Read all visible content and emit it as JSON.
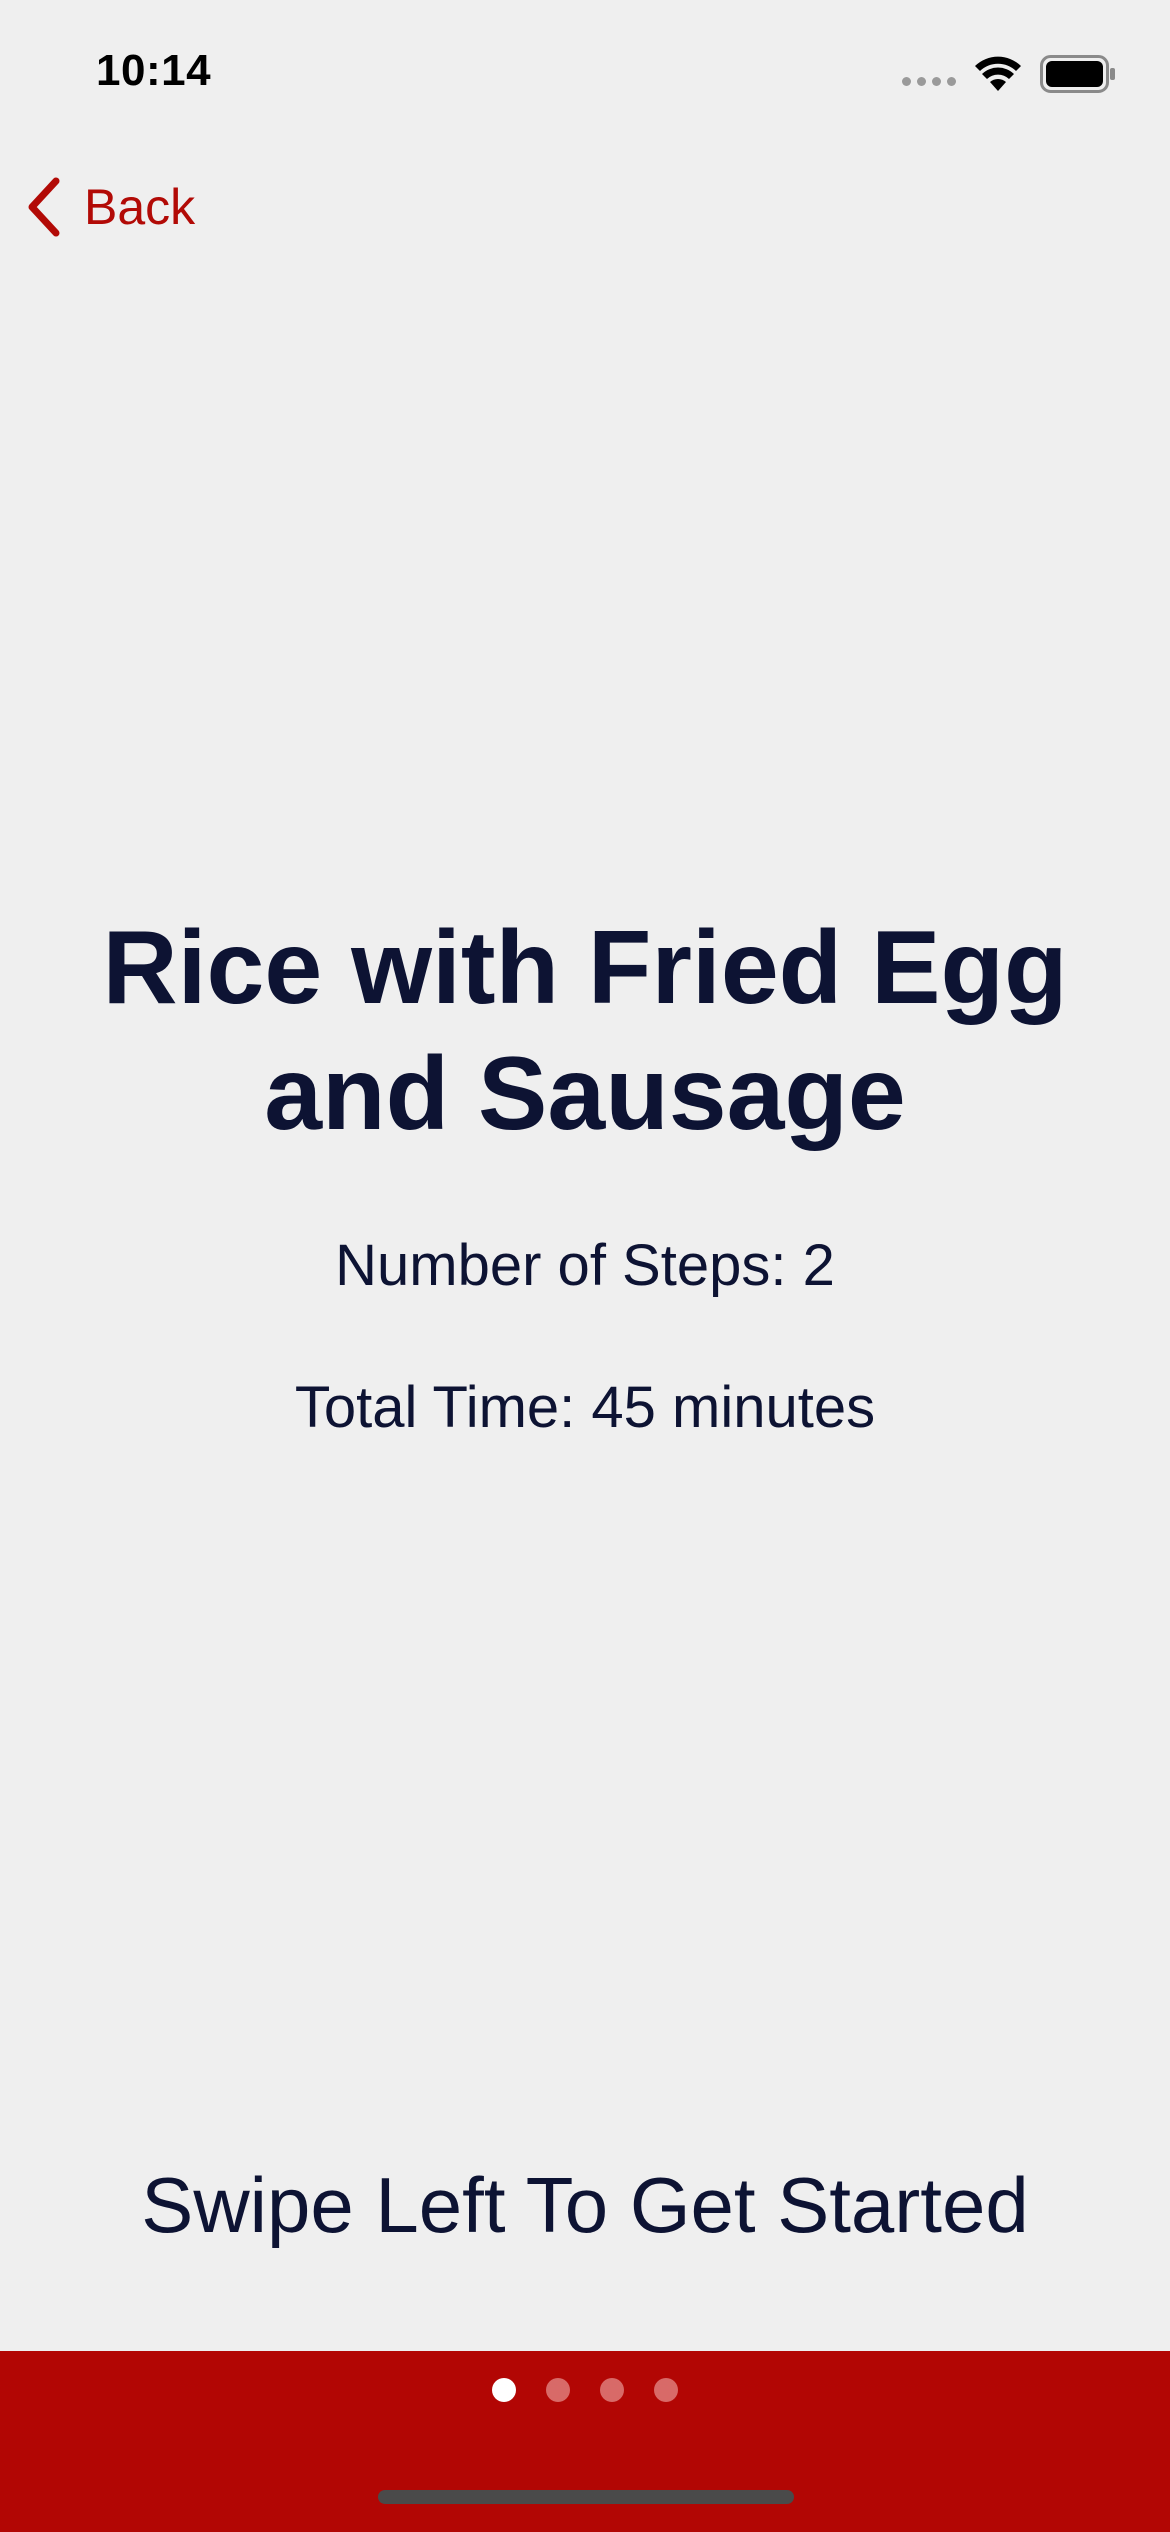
{
  "status_bar": {
    "time": "10:14",
    "icons": [
      "signal-icon",
      "wifi-icon",
      "battery-icon"
    ]
  },
  "nav": {
    "back_label": "Back",
    "back_icon": "chevron-left-icon"
  },
  "recipe": {
    "title": "Rice with Fried Egg and Sausage",
    "steps": "Number of Steps: 2",
    "total_time": "Total Time: 45 minutes"
  },
  "hint": "Swipe Left To Get Started",
  "pagination": {
    "current_page": 1,
    "total_pages": 4
  },
  "colors": {
    "accent": "#b20a06",
    "text": "#0d1333",
    "background": "#efefef"
  }
}
